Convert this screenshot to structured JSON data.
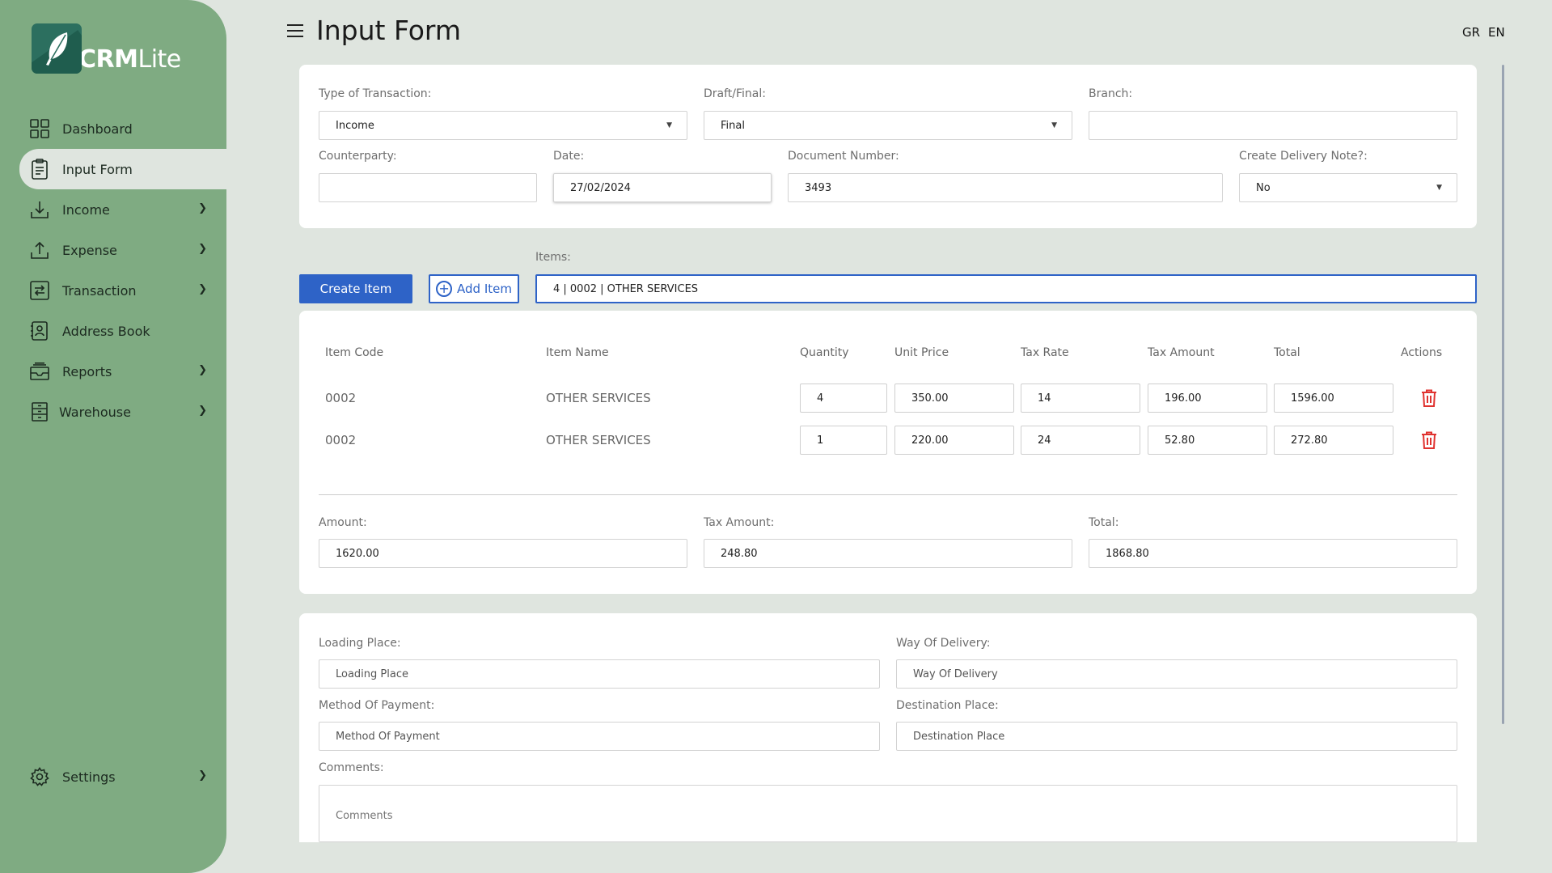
{
  "app": {
    "logo_bold": "CRM",
    "logo_light": "Lite"
  },
  "sidebar": {
    "items": [
      {
        "label": "Dashboard",
        "icon": "dashboard-grid-icon",
        "active": false,
        "chevron": false
      },
      {
        "label": "Input Form",
        "icon": "clipboard-icon",
        "active": true,
        "chevron": false
      },
      {
        "label": "Income",
        "icon": "download-icon",
        "active": false,
        "chevron": true
      },
      {
        "label": "Expense",
        "icon": "upload-icon",
        "active": false,
        "chevron": true
      },
      {
        "label": "Transaction",
        "icon": "transfer-icon",
        "active": false,
        "chevron": true
      },
      {
        "label": "Address Book",
        "icon": "address-book-icon",
        "active": false,
        "chevron": false
      },
      {
        "label": "Reports",
        "icon": "inbox-icon",
        "active": false,
        "chevron": true
      },
      {
        "label": "Warehouse",
        "icon": "warehouse-icon",
        "active": false,
        "chevron": true
      }
    ],
    "settings_label": "Settings"
  },
  "header": {
    "title": "Input Form",
    "lang_gr": "GR",
    "lang_en": "EN"
  },
  "transaction": {
    "type_label": "Type of Transaction:",
    "type_value": "Income",
    "draft_label": "Draft/Final:",
    "draft_value": "Final",
    "branch_label": "Branch:",
    "branch_value": "",
    "counterparty_label": "Counterparty:",
    "counterparty_value": "",
    "date_label": "Date:",
    "date_value": "27/02/2024",
    "docnum_label": "Document Number:",
    "docnum_value": "3493",
    "delivery_label": "Create Delivery Note?:",
    "delivery_value": "No"
  },
  "items_bar": {
    "create_label": "Create Item",
    "add_label": "Add Item",
    "items_label": "Items:",
    "items_value": "4 | 0002 | OTHER SERVICES"
  },
  "table": {
    "headers": [
      "Item Code",
      "Item Name",
      "Quantity",
      "Unit Price",
      "Tax Rate",
      "Tax Amount",
      "Total",
      "Actions"
    ],
    "rows": [
      {
        "code": "0002",
        "name": "OTHER SERVICES",
        "quantity": "4",
        "unit_price": "350.00",
        "tax_rate": "14",
        "tax_amount": "196.00",
        "total": "1596.00"
      },
      {
        "code": "0002",
        "name": "OTHER SERVICES",
        "quantity": "1",
        "unit_price": "220.00",
        "tax_rate": "24",
        "tax_amount": "52.80",
        "total": "272.80"
      }
    ]
  },
  "totals": {
    "amount_label": "Amount:",
    "amount_value": "1620.00",
    "tax_label": "Tax Amount:",
    "tax_value": "248.80",
    "total_label": "Total:",
    "total_value": "1868.80"
  },
  "delivery": {
    "loading_label": "Loading Place:",
    "loading_placeholder": "Loading Place",
    "way_label": "Way Of Delivery:",
    "way_placeholder": "Way Of Delivery",
    "payment_label": "Method Of Payment:",
    "payment_placeholder": "Method Of Payment",
    "destination_label": "Destination Place:",
    "destination_placeholder": "Destination Place",
    "comments_label": "Comments:",
    "comments_placeholder": "Comments"
  },
  "colors": {
    "sidebar": "#7fab82",
    "background": "#dfe5df",
    "primary": "#2e63c7",
    "danger": "#e0322f"
  }
}
